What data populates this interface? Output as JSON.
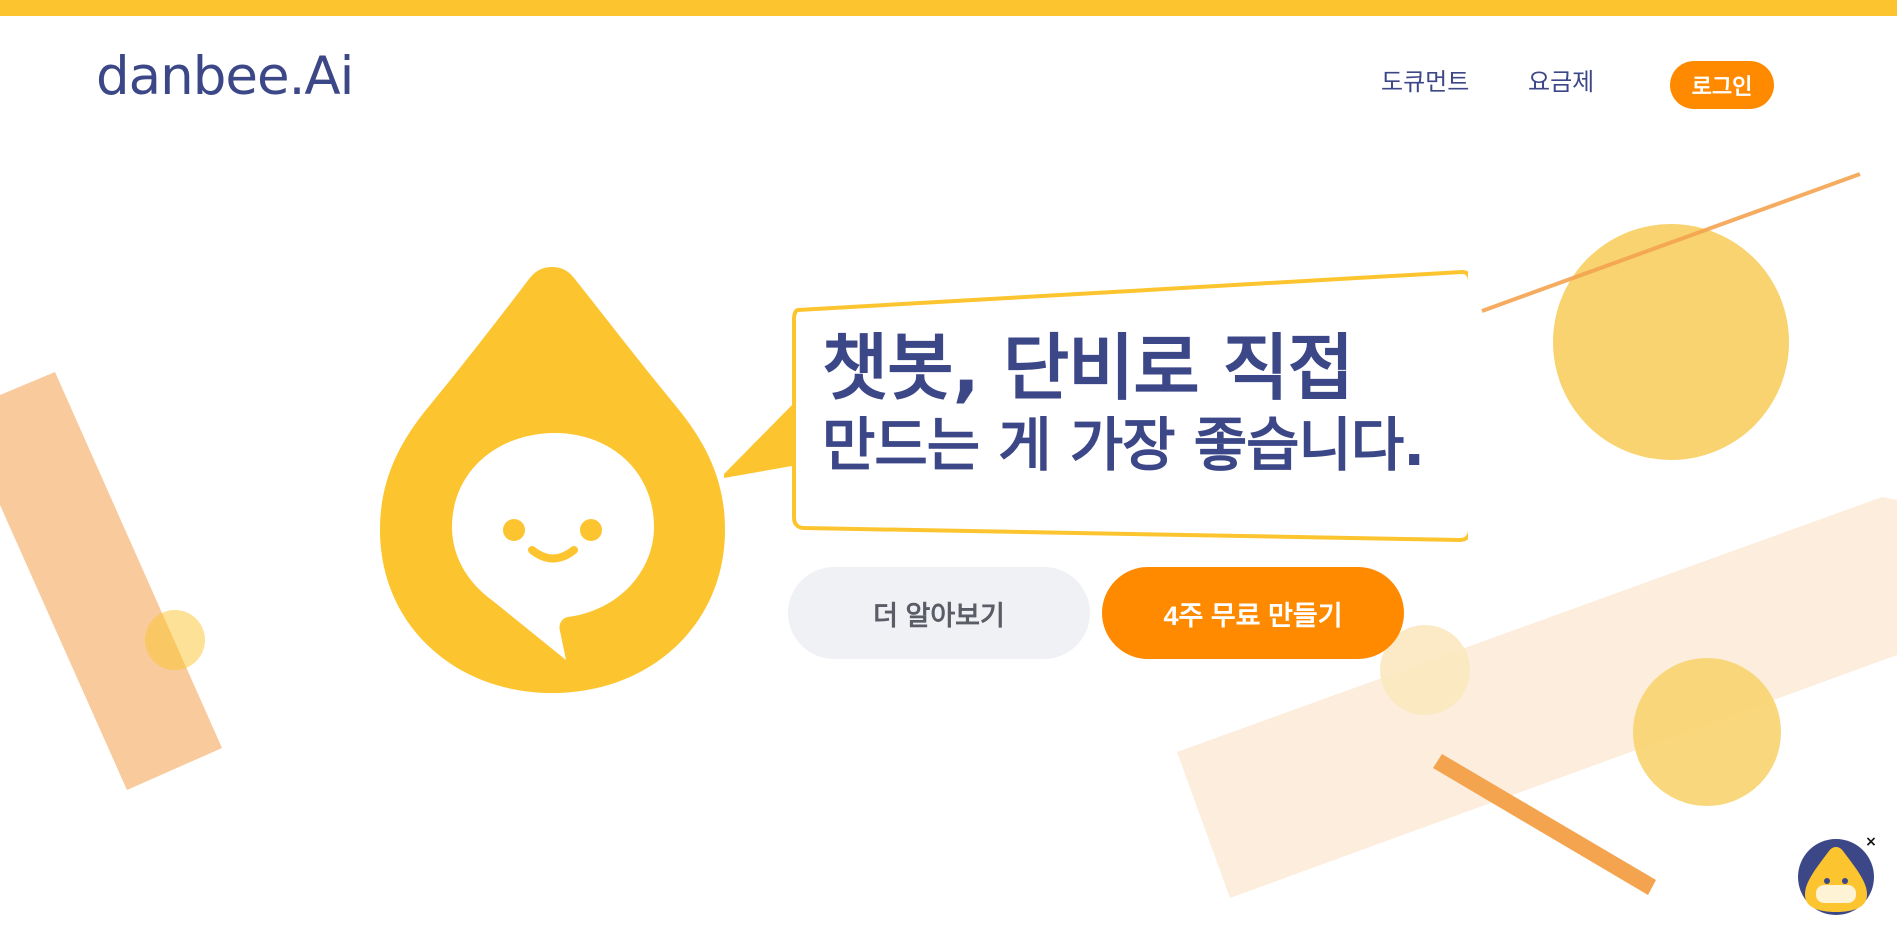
{
  "header": {
    "logo_text": "danbee.Ai",
    "nav": {
      "docs_label": "도큐먼트",
      "pricing_label": "요금제",
      "login_label": "로그인"
    }
  },
  "hero": {
    "headline_line1": "챗봇, 단비로 직접",
    "headline_line2": "만드는 게 가장 좋습니다.",
    "learn_more_label": "더 알아보기",
    "free_trial_label": "4주 무료 만들기"
  },
  "chat_widget": {
    "close_symbol": "×",
    "icon": "mascot-icon"
  },
  "colors": {
    "accent_yellow": "#fcc42e",
    "accent_orange": "#ff8a00",
    "brand_navy": "#3c4787",
    "button_gray": "#f0f1f5"
  }
}
